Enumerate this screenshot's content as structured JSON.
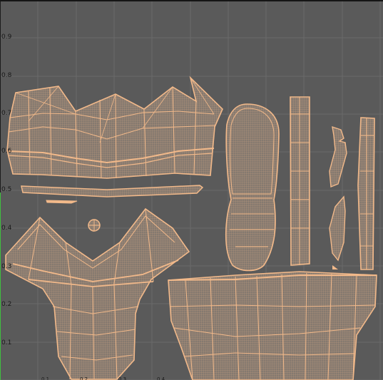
{
  "window": {
    "background": "#5a5a5a",
    "grid_color": "#6a6a6a",
    "mesh_color": "#f2b98a",
    "fill_color": "#8a7d72"
  },
  "axis": {
    "v_ticks": [
      "0.9",
      "0.8",
      "0.7",
      "0.6",
      "0.5",
      "0.4",
      "0.3",
      "0.2",
      "0.1"
    ],
    "u_ticks": [
      "0.1",
      "0.2",
      "0.3",
      "0.4"
    ]
  }
}
